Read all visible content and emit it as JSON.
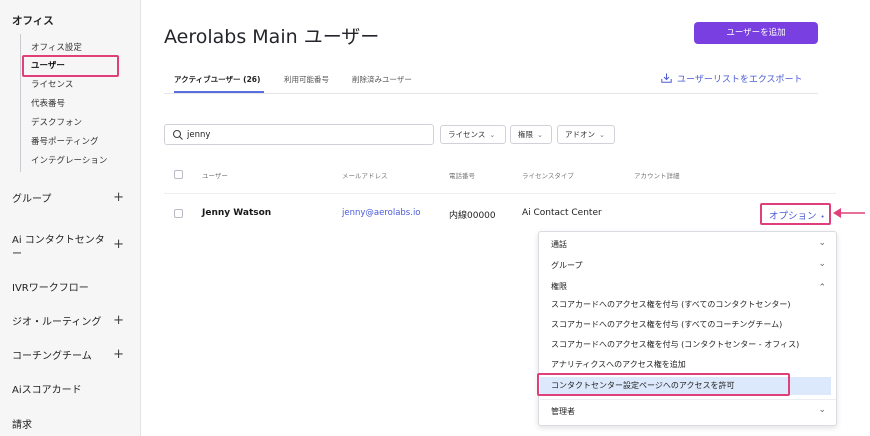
{
  "sidebar": {
    "title": "オフィス",
    "sub_items": [
      {
        "label": "オフィス設定"
      },
      {
        "label": "ユーザー"
      },
      {
        "label": "ライセンス"
      },
      {
        "label": "代表番号"
      },
      {
        "label": "デスクフォン"
      },
      {
        "label": "番号ポーティング"
      },
      {
        "label": "インテグレーション"
      }
    ],
    "active_item": "ユーザー",
    "sections": [
      {
        "label": "グループ",
        "expand": "+"
      },
      {
        "label": "Ai コンタクトセンター",
        "expand": "+"
      },
      {
        "label": "IVRワークフロー",
        "expand": ""
      },
      {
        "label": "ジオ・ルーティング",
        "expand": "+"
      },
      {
        "label": "コーチングチーム",
        "expand": "+"
      },
      {
        "label": "Aiスコアカード",
        "expand": ""
      },
      {
        "label": "請求",
        "expand": ""
      }
    ]
  },
  "header": {
    "title": "Aerolabs Main ユーザー",
    "add_user_label": "ユーザーを追加"
  },
  "tabs": [
    {
      "label": "アクティブユーザー (26)",
      "active": true
    },
    {
      "label": "利用可能番号",
      "active": false
    },
    {
      "label": "削除済みユーザー",
      "active": false
    }
  ],
  "export_label": "ユーザーリストをエクスポート",
  "search": {
    "value": "jenny"
  },
  "filters": [
    {
      "label": "ライセンス"
    },
    {
      "label": "権限"
    },
    {
      "label": "アドオン"
    }
  ],
  "table": {
    "columns": [
      "ユーザー",
      "メールアドレス",
      "電話番号",
      "ライセンスタイプ",
      "アカウント詳細"
    ],
    "rows": [
      {
        "name": "Jenny Watson",
        "email": "jenny@aerolabs.io",
        "phone": "内線00000",
        "license": "Ai Contact Center",
        "options_label": "オプション"
      }
    ]
  },
  "options_menu": {
    "items": [
      {
        "label": "通話",
        "chevron": "⌄"
      },
      {
        "label": "グループ",
        "chevron": "⌄"
      },
      {
        "label": "権限",
        "chevron": "⌃"
      },
      {
        "label": "スコアカードへのアクセス権を付与 (すべてのコンタクトセンター)"
      },
      {
        "label": "スコアカードへのアクセス権を付与 (すべてのコーチングチーム)"
      },
      {
        "label": "スコアカードへのアクセス権を付与 (コンタクトセンター - オフィス)"
      },
      {
        "label": "アナリティクスへのアクセス権を追加"
      },
      {
        "label": "コンタクトセンター設定ページへのアクセスを許可"
      },
      {
        "label": "管理者",
        "chevron": "⌄"
      }
    ]
  },
  "colors": {
    "accent": "#7a3fe0",
    "link": "#4a5bd6",
    "highlight": "#e0407a",
    "selected_item_bg": "#dce8fb"
  }
}
